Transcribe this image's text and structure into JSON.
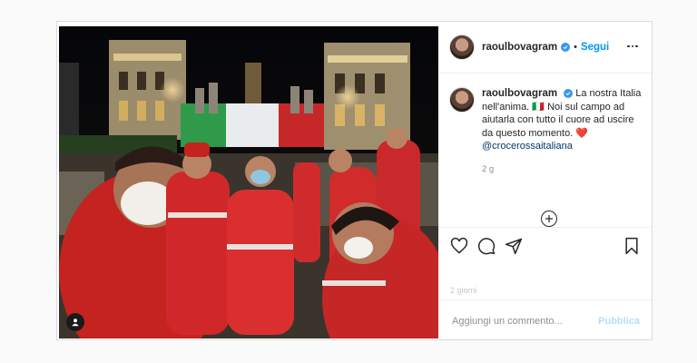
{
  "post": {
    "username": "raoulbovagram",
    "follow_label": "Segui",
    "separator": "•",
    "caption": {
      "line1": "La nostra Italia nell'anima.",
      "flag_emoji": "🇮🇹",
      "line2": "Noi sul campo ad aiutarla con tutto il cuore ad uscire da questo momento.",
      "heart_emoji": "❤️",
      "mention": "@crocerossaitaliana"
    },
    "time_ago": "2 g",
    "faded_text": "2 giorni"
  },
  "comment": {
    "placeholder": "Aggiungi un commento...",
    "publish_label": "Pubblica"
  },
  "colors": {
    "accent": "#0095f6",
    "verified": "#3897f0",
    "publish_disabled": "#b2dffc"
  },
  "icons": [
    "more-options-icon",
    "verified-badge-icon",
    "heart-icon",
    "comment-icon",
    "share-icon",
    "bookmark-icon",
    "plus-circle-icon",
    "tag-user-icon"
  ]
}
